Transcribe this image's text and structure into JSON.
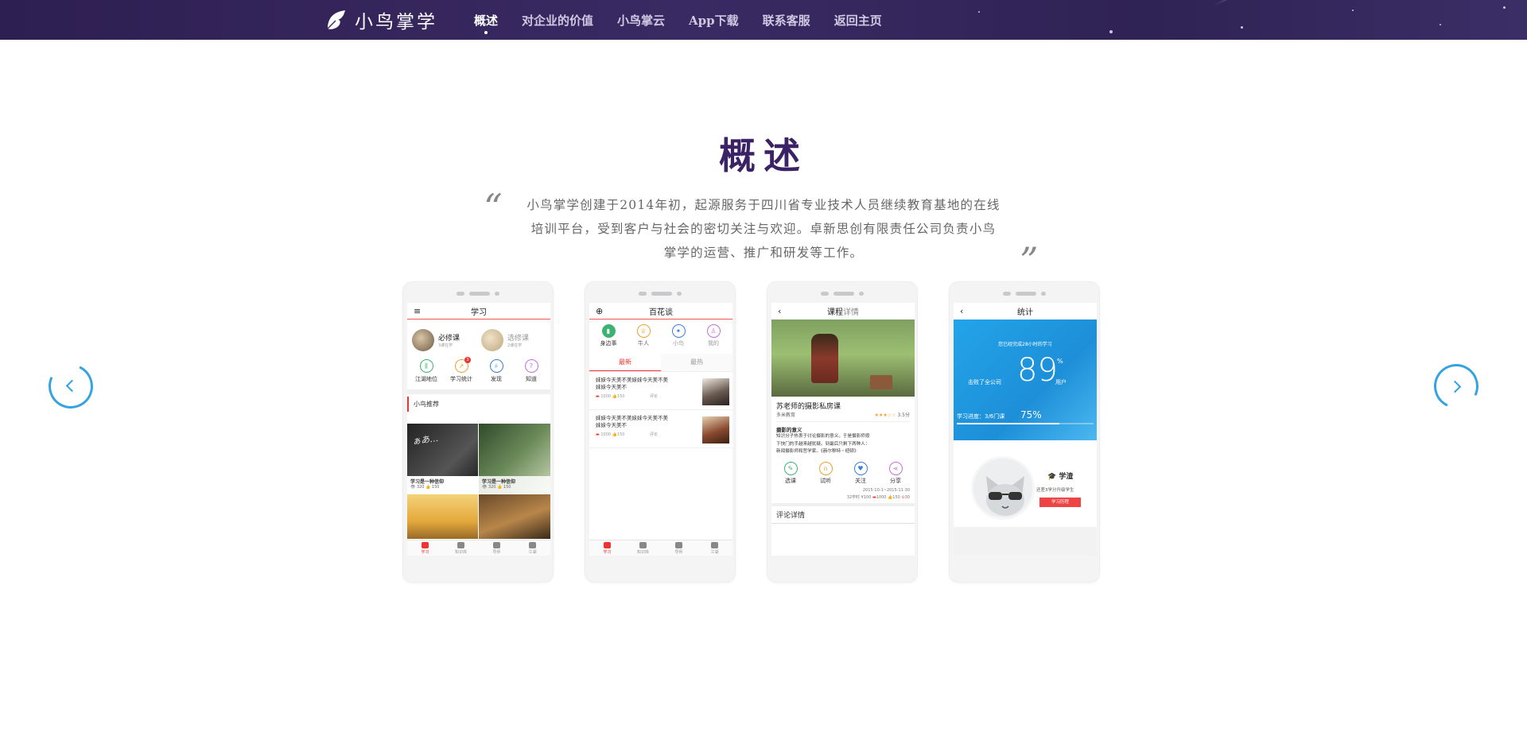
{
  "app": {
    "name": "小鸟掌学"
  },
  "nav": {
    "items": [
      {
        "label": "概述",
        "active": true
      },
      {
        "label": "对企业的价值"
      },
      {
        "label": "小鸟掌云"
      },
      {
        "label": "App下载"
      },
      {
        "label": "联系客服"
      },
      {
        "label": "返回主页"
      }
    ]
  },
  "overview": {
    "title": "概述",
    "open_quote": "“",
    "close_quote": "”",
    "lines": [
      "小鸟掌学创建于2014年初，起源服务于四川省专业技术人员继续教育基地的在线",
      "培训平台，受到客户与社会的密切关注与欢迎。卓新思创有限责任公司负责小鸟",
      "掌学的运营、推广和研发等工作。"
    ]
  },
  "carousel": {
    "prev_icon": "chevron-left-icon",
    "next_icon": "chevron-right-icon"
  },
  "phone1": {
    "title": "学习",
    "required": {
      "label": "必修课",
      "sub": "3课在学"
    },
    "elective": {
      "label": "选修课",
      "sub": "2课在学"
    },
    "grid": [
      "江湖地位",
      "学习统计",
      "发现",
      "知道"
    ],
    "badge": "3",
    "section": "小鸟推荐",
    "cards": [
      {
        "title": "学习是一种信仰",
        "views": "320",
        "likes": "150"
      },
      {
        "title": "学习是一种信仰",
        "views": "320",
        "likes": "150"
      }
    ],
    "tabs": [
      "学习",
      "知识库",
      "导师",
      "江湖"
    ]
  },
  "phone2": {
    "title": "百花谈",
    "grid": [
      "身边事",
      "牛人",
      "小鸟",
      "我的"
    ],
    "tabs": [
      "最新",
      "最热"
    ],
    "posts": [
      {
        "text1": "妹妹今天美不美妹妹今天美不美",
        "text2": "妹妹今天美不",
        "count": "1000",
        "likes": "150",
        "reply": "评论"
      },
      {
        "text1": "妹妹今天美不美妹妹今天美不美",
        "text2": "妹妹今天美不",
        "count": "1000",
        "likes": "150",
        "reply": "评论"
      }
    ],
    "bottom_tabs": [
      "学习",
      "知识库",
      "导师",
      "江湖"
    ]
  },
  "phone3": {
    "title_a": "课程",
    "title_b": "详情",
    "course": "苏老师的摄影私房课",
    "org": "多米教育",
    "rating": "3.5分",
    "intro_title": "摄影的意义",
    "intro": [
      "知识分子热衷于讨论摄影的意义。于是摄影师按",
      "下快门的手越来越犹疑。到最后只剩下两种人：",
      "新闻摄影师和哲学家。《赫尔穆特・纽顿》"
    ],
    "actions": [
      "选课",
      "试听",
      "关注",
      "分享"
    ],
    "date": "2015-10-1~2015-11-30",
    "hours": "32学时",
    "price": "100",
    "count": "1000",
    "likes": "150",
    "time": "30",
    "comments": "评论详情"
  },
  "phone4": {
    "title": "统计",
    "top_text": "您已经完成28小时的学习",
    "percent": "89",
    "percent_sign": "%",
    "beat_left": "击败了全公司",
    "beat_right": "用户",
    "progress_label": "学习进度：3/6门课",
    "progress_value": "75%",
    "progress_fraction": 0.75,
    "user": "学渣",
    "user_note": "还差3学分升级学生",
    "history_btn": "学习历程"
  },
  "colors": {
    "topbar": "#2e1f52",
    "title": "#3b2165",
    "accent": "#36a3e1",
    "red": "#ee4444",
    "blue": "#2aa0e8"
  }
}
